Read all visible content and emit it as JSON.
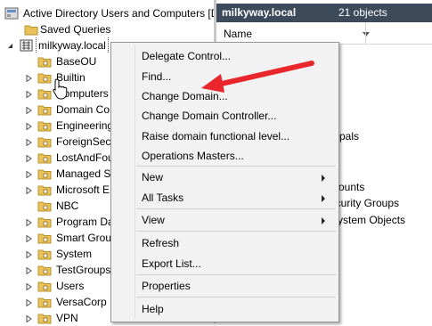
{
  "tree": {
    "root_label": "Active Directory Users and Computers [D",
    "saved_queries": "Saved Queries",
    "domain": "milkyway.local",
    "ous": [
      "BaseOU",
      "Builtin",
      "Computers",
      "Domain Co",
      "Engineering",
      "ForeignSecu",
      "LostAndFou",
      "Managed Se",
      "Microsoft E",
      "NBC",
      "Program Da",
      "Smart Grou",
      "System",
      "TestGroups",
      "Users",
      "VersaCorp",
      "VPN"
    ]
  },
  "right_pane": {
    "title": "milkyway.local",
    "count": "21 objects",
    "column_name": "Name",
    "partial_items": [
      "pals",
      "counts",
      "ecurity Groups",
      "System Objects"
    ]
  },
  "context_menu": {
    "items": [
      "Delegate Control...",
      "Find...",
      "Change Domain...",
      "Change Domain Controller...",
      "Raise domain functional level...",
      "Operations Masters...",
      "New",
      "All Tasks",
      "View",
      "Refresh",
      "Export List...",
      "Properties",
      "Help"
    ]
  },
  "colors": {
    "annotation_arrow": "#e8262c",
    "header_bg": "#3d4a5a",
    "folder_yellow": "#e9c35a"
  }
}
